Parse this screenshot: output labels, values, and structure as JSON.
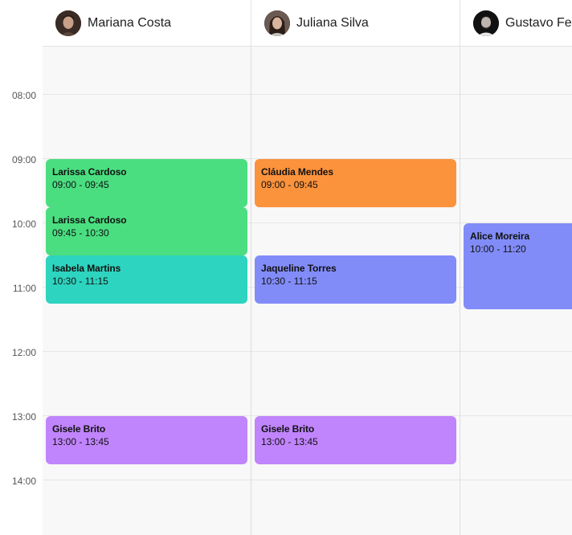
{
  "staff": [
    {
      "name": "Mariana Costa"
    },
    {
      "name": "Juliana Silva"
    },
    {
      "name": "Gustavo Ferreira"
    }
  ],
  "time_labels": [
    "08:00",
    "09:00",
    "10:00",
    "11:00",
    "12:00",
    "13:00",
    "14:00"
  ],
  "colors": {
    "green": "#4ade80",
    "orange": "#fb923c",
    "teal": "#2dd4bf",
    "indigo": "#818cf8",
    "purple": "#c084fc"
  },
  "appointments": [
    {
      "staff": "Mariana Costa",
      "client": "Larissa Cardoso",
      "time": "09:00 - 09:45",
      "color": "#4ade80"
    },
    {
      "staff": "Mariana Costa",
      "client": "Larissa Cardoso",
      "time": "09:45 - 10:30",
      "color": "#4ade80"
    },
    {
      "staff": "Mariana Costa",
      "client": "Isabela Martins",
      "time": "10:30 - 11:15",
      "color": "#2dd4bf"
    },
    {
      "staff": "Mariana Costa",
      "client": "Gisele Brito",
      "time": "13:00 - 13:45",
      "color": "#c084fc"
    },
    {
      "staff": "Juliana Silva",
      "client": "Cláudia Mendes",
      "time": "09:00 - 09:45",
      "color": "#fb923c"
    },
    {
      "staff": "Juliana Silva",
      "client": "Jaqueline Torres",
      "time": "10:30 - 11:15",
      "color": "#818cf8"
    },
    {
      "staff": "Juliana Silva",
      "client": "Gisele Brito",
      "time": "13:00 - 13:45",
      "color": "#c084fc"
    },
    {
      "staff": "Gustavo Ferreira",
      "client": "Alice Moreira",
      "time": "10:00 - 11:20",
      "color": "#818cf8"
    }
  ]
}
